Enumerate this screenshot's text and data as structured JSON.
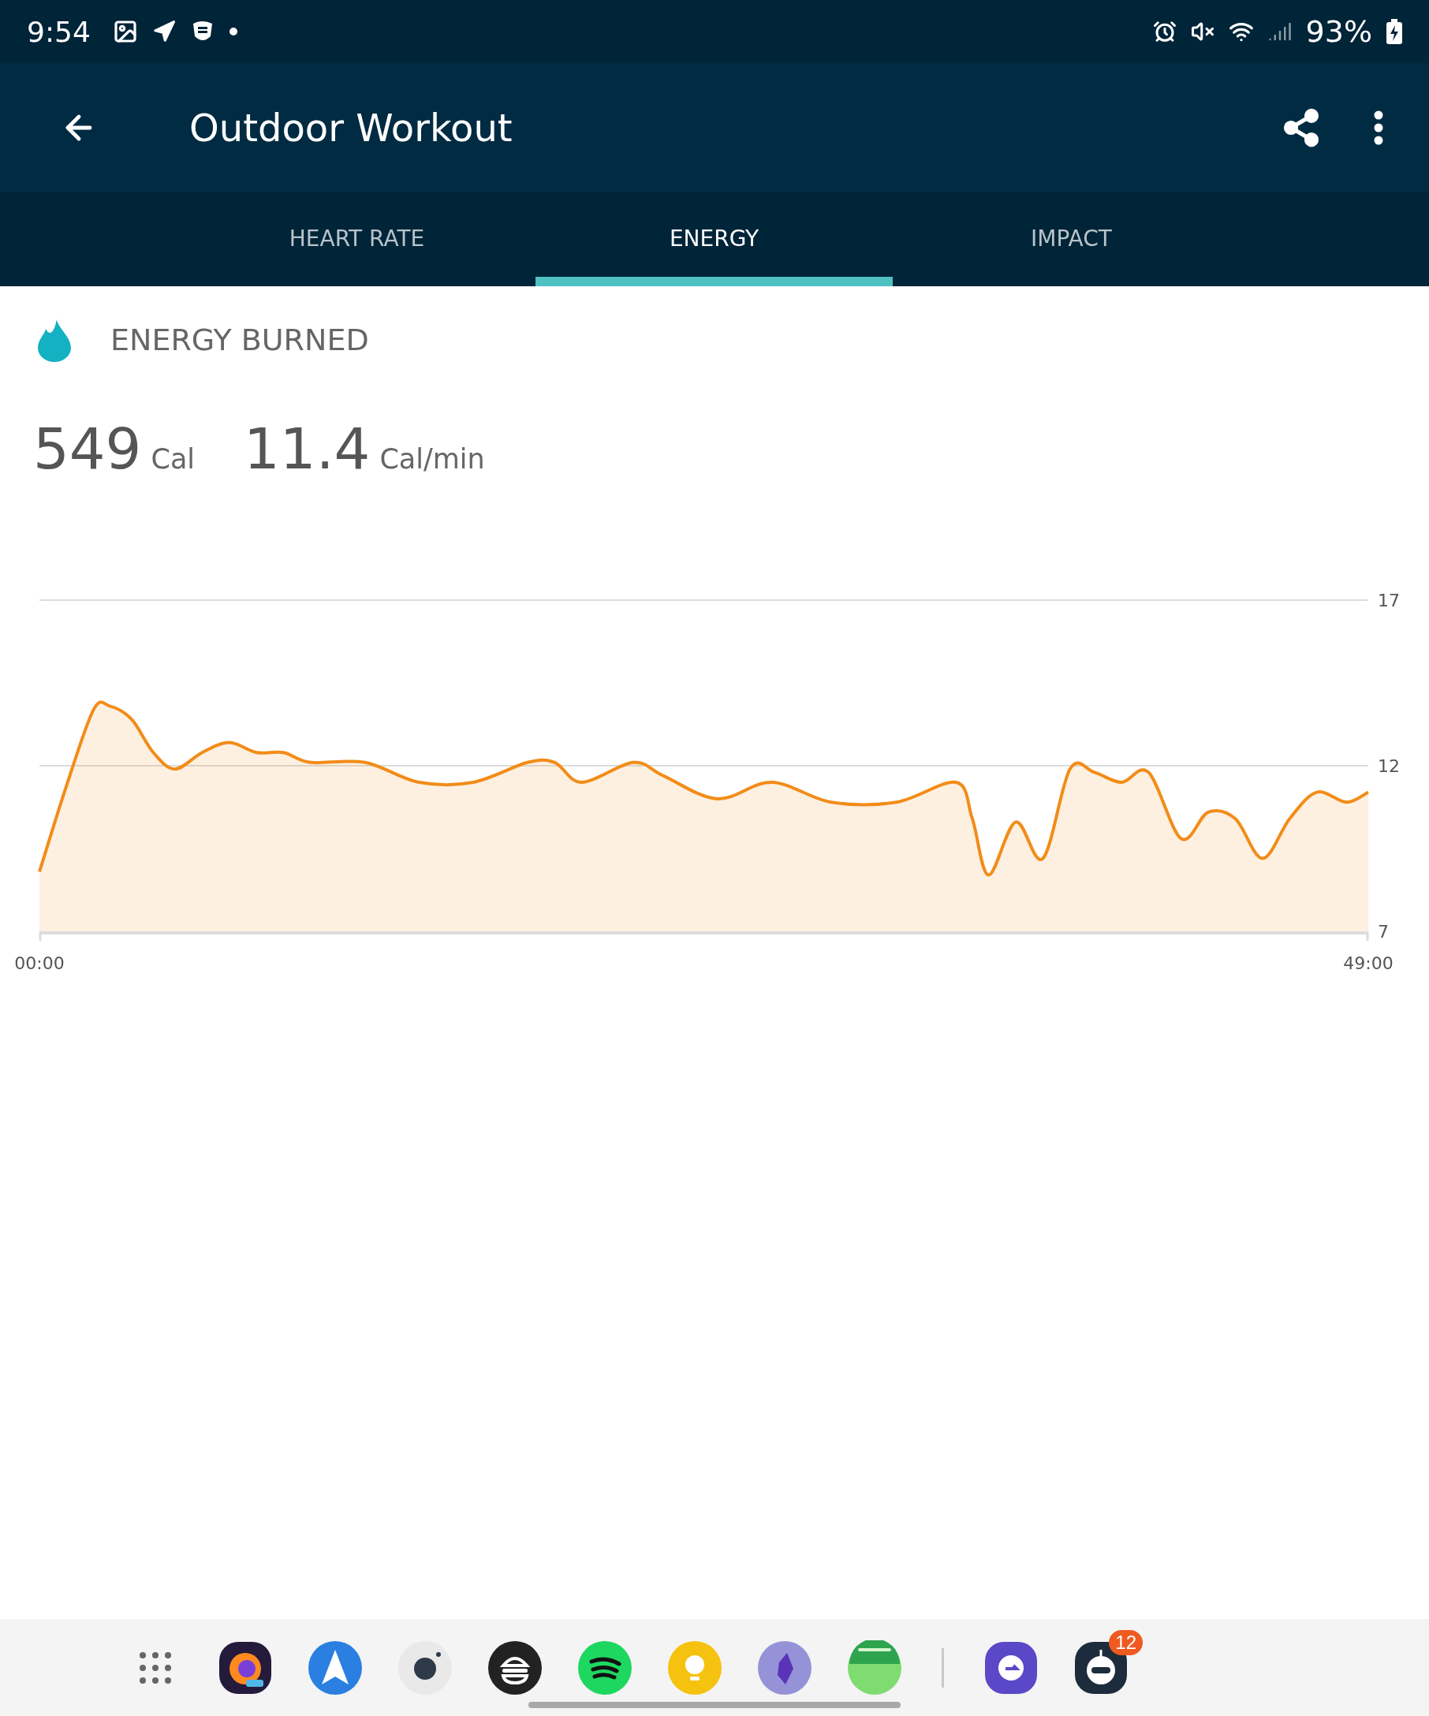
{
  "status_bar": {
    "time": "9:54",
    "battery": "93%"
  },
  "app_bar": {
    "title": "Outdoor Workout"
  },
  "tabs": [
    {
      "label": "HEART RATE",
      "selected": false
    },
    {
      "label": "ENERGY",
      "selected": true
    },
    {
      "label": "IMPACT",
      "selected": false
    }
  ],
  "section": {
    "title": "ENERGY BURNED"
  },
  "stats": [
    {
      "value": "549",
      "unit": "Cal"
    },
    {
      "value": "11.4",
      "unit": "Cal/min"
    }
  ],
  "chart_data": {
    "type": "area",
    "x": [
      0,
      1,
      2,
      2.6,
      3.4,
      4.2,
      5,
      6,
      7,
      8,
      9,
      10,
      12,
      14,
      16,
      18,
      19,
      20,
      21.9,
      23,
      25,
      27,
      29.2,
      31.6,
      33.8,
      34.4,
      35,
      36,
      37,
      38,
      38.9,
      39.9,
      40.9,
      42.1,
      43.1,
      44.1,
      45.1,
      46.1,
      47.1,
      48.2,
      49
    ],
    "series": [
      {
        "color": "#f28c18",
        "values": [
          8.8,
          11.4,
          13.7,
          13.8,
          13.4,
          12.4,
          11.9,
          12.4,
          12.7,
          12.4,
          12.4,
          12.1,
          12.1,
          11.5,
          11.5,
          12.1,
          12.1,
          11.5,
          12.1,
          11.7,
          11.0,
          11.5,
          10.9,
          10.9,
          11.5,
          10.4,
          8.7,
          10.3,
          9.2,
          11.9,
          11.8,
          11.5,
          11.8,
          9.8,
          10.6,
          10.4,
          9.2,
          10.4,
          11.2,
          10.9,
          11.2
        ]
      }
    ],
    "xlim": [
      0,
      49
    ],
    "ylim": [
      7,
      17
    ],
    "yticks": [
      7,
      12,
      17
    ],
    "xticks": [
      {
        "value": 0,
        "label": "00:00"
      },
      {
        "value": 49,
        "label": "49:00"
      }
    ]
  },
  "dock": {
    "badge": "12"
  }
}
